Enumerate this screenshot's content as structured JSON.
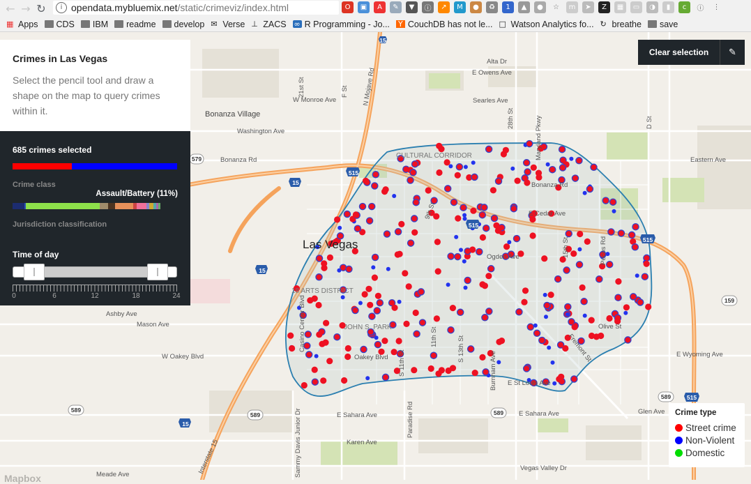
{
  "browser": {
    "url_host": "opendata.mybluemix.net",
    "url_path": "/static/crimeviz/index.html",
    "bookmarks": [
      {
        "label": "Apps",
        "icon": "apps-grid-icon"
      },
      {
        "label": "CDS",
        "icon": "folder-icon"
      },
      {
        "label": "IBM",
        "icon": "folder-icon"
      },
      {
        "label": "readme",
        "icon": "folder-icon"
      },
      {
        "label": "develop",
        "icon": "folder-icon"
      },
      {
        "label": "Verse",
        "icon": "envelope-icon"
      },
      {
        "label": "ZACS",
        "icon": "tool-icon"
      },
      {
        "label": "R Programming - Jo...",
        "icon": "infinity-icon"
      },
      {
        "label": "CouchDB has not le...",
        "icon": "y-combinator-icon"
      },
      {
        "label": "Watson Analytics fo...",
        "icon": "page-icon"
      },
      {
        "label": "breathe",
        "icon": "circle-arrow-icon"
      },
      {
        "label": "save",
        "icon": "folder-icon"
      }
    ]
  },
  "panel": {
    "title": "Crimes in Las Vegas",
    "description": "Select the pencil tool and draw a shape on the map to query crimes within it.",
    "selected_count": "685 crimes selected",
    "crime_class_label": "Crime class",
    "hover_label": "Assault/Battery (11%)",
    "jurisdiction_label": "Jurisdiction classification",
    "time_of_day_label": "Time of day",
    "time_range": {
      "min": 0,
      "max": 24,
      "start": 3,
      "end": 21
    },
    "tick_labels": [
      "0",
      "6",
      "12",
      "18",
      "24"
    ],
    "selection_split": {
      "street": 0.36,
      "nonviolent": 0.64
    }
  },
  "toolbar": {
    "clear_label": "Clear selection",
    "pencil_icon": "pencil-icon"
  },
  "legend": {
    "title": "Crime type",
    "items": [
      {
        "label": "Street crime",
        "color": "#ff0000"
      },
      {
        "label": "Non-Violent",
        "color": "#0000ff"
      },
      {
        "label": "Domestic",
        "color": "#00dd00"
      }
    ]
  },
  "map": {
    "city_label": "Las Vegas",
    "streets": [
      "Alta Dr",
      "E Owens Ave",
      "W Monroe Ave",
      "Searles Ave",
      "Bonanza Village",
      "Washington Ave",
      "Bonanza Rd",
      "Bonanza Rd",
      "E Cedar Ave",
      "CULTURAL CORRIDOR",
      "Ogden Ave",
      "18 ARTS DISTRICT",
      "JOHN S. PARK",
      "Fremont St",
      "Olive St",
      "Ashby Ave",
      "Mason Ave",
      "W Oakey Blvd",
      "Oakey Blvd",
      "E St Louis Ave",
      "E Sahara Ave",
      "E Sahara Ave",
      "Karen Ave",
      "Glen Ave",
      "E Wyoming Ave",
      "Meade Ave",
      "Vegas Valley Dr",
      "Eastern Ave",
      "Maryland Pkwy",
      "Paradise Rd",
      "Sammy Davis Junior Dr",
      "Interstate 15",
      "N Mojave Rd",
      "Pecos Rd",
      "D St",
      "F St",
      "21st St",
      "28th St",
      "15th St",
      "11th St",
      "S 11th St",
      "S 13th St",
      "Burnham Ave",
      "9th St",
      "Charleston Blvd",
      "Casino Center Blvd",
      "Sierra Vista Dr",
      "Las Vegas Blvd"
    ],
    "shields": [
      "15",
      "515",
      "579",
      "159",
      "589",
      "589",
      "589",
      "589"
    ],
    "attribution": "Mapbox"
  }
}
